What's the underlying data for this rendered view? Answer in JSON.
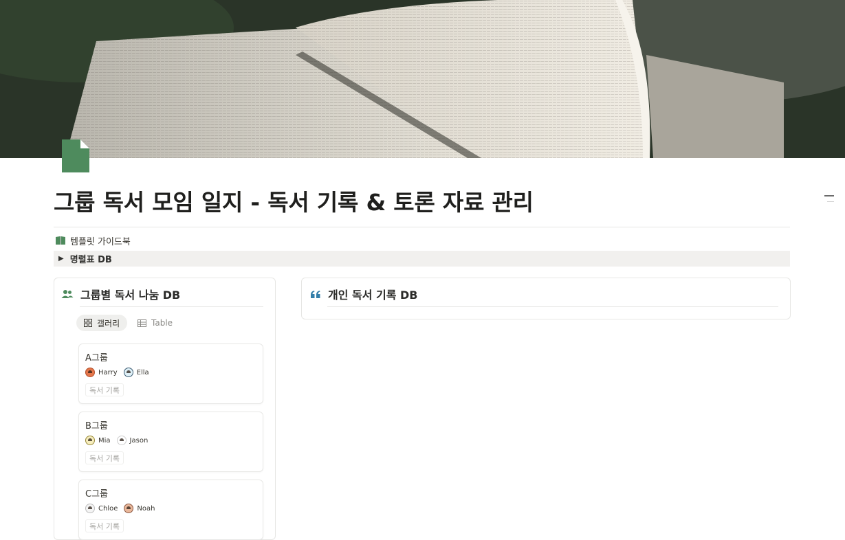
{
  "cover": {
    "alt": "open book cover image"
  },
  "page": {
    "icon": "document-icon",
    "title": "그룹 독서 모임 일지 - 독서 기록 & 토론 자료 관리"
  },
  "guide_link": {
    "icon": "open-book-icon",
    "label": "템플릿 가이드북"
  },
  "toggle": {
    "icon": "triangle-right-icon",
    "label": "명렬표 DB"
  },
  "group_db": {
    "icon": "people-icon",
    "title": "그룹별 독서 나눔 DB",
    "views": [
      {
        "label": "갤러리",
        "icon": "gallery-icon",
        "active": true
      },
      {
        "label": "Table",
        "icon": "table-icon",
        "active": false
      }
    ],
    "cards": [
      {
        "title": "A그룹",
        "members": [
          "Harry",
          "Ella"
        ],
        "tag": "독서 기록"
      },
      {
        "title": "B그룹",
        "members": [
          "Mia",
          "Jason"
        ],
        "tag": "독서 기록"
      },
      {
        "title": "C그룹",
        "members": [
          "Chloe",
          "Noah"
        ],
        "tag": "독서 기록"
      }
    ]
  },
  "personal_db": {
    "icon": "quote-icon",
    "title": "개인 독서 기록 DB"
  },
  "colors": {
    "accent_green": "#4e8b5d",
    "quote_blue": "#337ea9",
    "toggle_bg": "#f1f0ee"
  }
}
